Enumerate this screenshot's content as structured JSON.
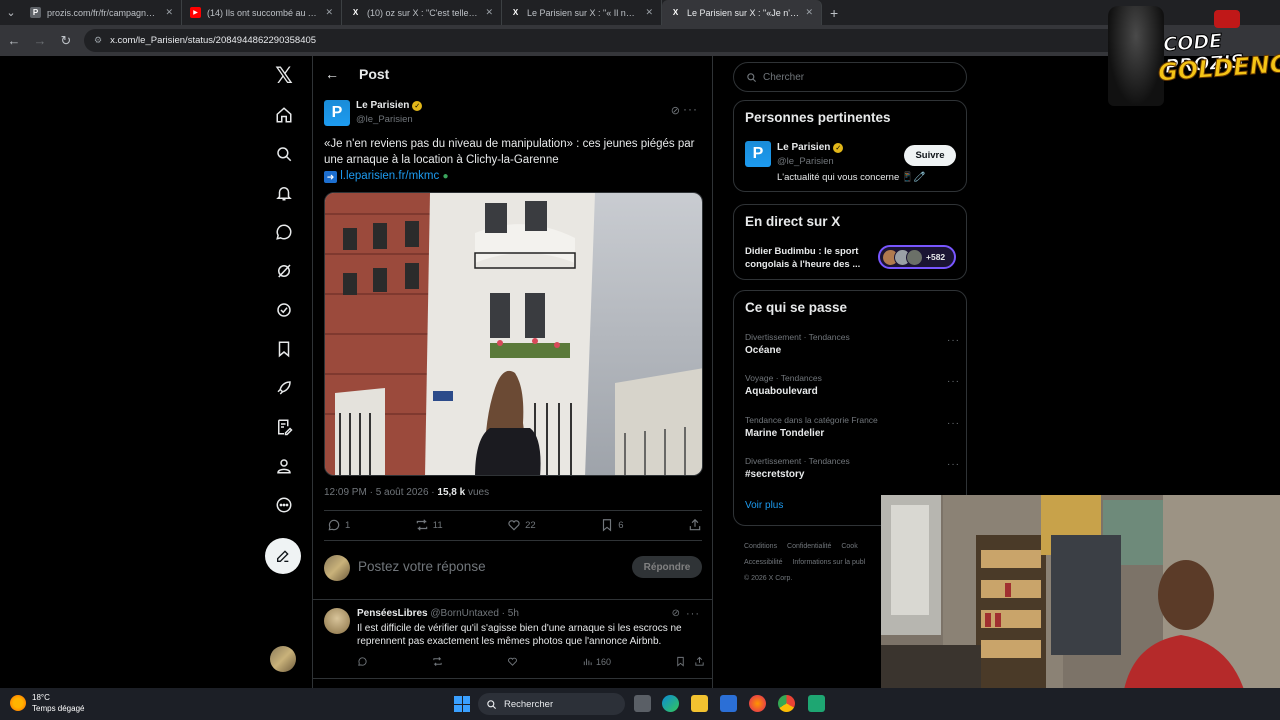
{
  "browser": {
    "tabs": [
      {
        "title": "prozis.com/fr/fr/campagne/74i",
        "fav_color": "#5f6368",
        "fav_char": "P",
        "active": false
      },
      {
        "title": "(14) Ils ont succombé au Air fry",
        "fav_color": "#ff0000",
        "fav_char": "▶",
        "active": false
      },
      {
        "title": "(10) oz sur X : \"C'est tellement",
        "fav_color": "#000000",
        "fav_char": "X",
        "active": false
      },
      {
        "title": "Le Parisien sur X : \"« Il nous l'a",
        "fav_color": "#000000",
        "fav_char": "X",
        "active": false
      },
      {
        "title": "Le Parisien sur X : \"«Je n'en revi",
        "fav_color": "#000000",
        "fav_char": "X",
        "active": true
      }
    ],
    "url": "x.com/le_Parisien/status/2084944862290358405"
  },
  "header": {
    "title": "Post"
  },
  "post": {
    "author_name": "Le Parisien",
    "author_handle": "@le_Parisien",
    "logo_letter": "P",
    "text": "«Je n'en reviens pas du niveau de manipulation» : ces jeunes piégés par une arnaque à la location à Clichy-la-Garenne",
    "link": "l.leparisien.fr/mkmc",
    "time": "12:09 PM · 5 août 2026 · ",
    "views_count": "15,8 k",
    "views_label": " vues",
    "replies": "1",
    "reposts": "11",
    "likes": "22",
    "bookmarks": "6"
  },
  "reply_box": {
    "placeholder": "Postez votre réponse",
    "button": "Répondre"
  },
  "comment": {
    "name": "PenséesLibres",
    "meta": " @BornUntaxed · 5h",
    "text": "Il est difficile de vérifier qu'il s'agisse bien d'une arnaque si les escrocs ne reprennent pas exactement les mêmes photos que l'annonce Airbnb.",
    "views": "160"
  },
  "right": {
    "search_placeholder": "Chercher",
    "relevant": {
      "title": "Personnes pertinentes",
      "name": "Le Parisien",
      "handle": "@le_Parisien",
      "bio": "L'actualité qui vous concerne 📱🧷",
      "follow": "Suivre"
    },
    "live": {
      "title": "En direct sur X",
      "text": "Didier Budimbu : le sport congolais à l'heure des ...",
      "count": "+582"
    },
    "trends": {
      "title": "Ce qui se passe",
      "items": [
        {
          "category": "Divertissement · Tendances",
          "name": "Océane"
        },
        {
          "category": "Voyage · Tendances",
          "name": "Aquaboulevard"
        },
        {
          "category": "Tendance dans la catégorie France",
          "name": "Marine Tondelier"
        },
        {
          "category": "Divertissement · Tendances",
          "name": "#secretstory"
        }
      ],
      "see_more": "Voir plus"
    },
    "footer": [
      "Conditions",
      "Confidentialité",
      "Cook",
      "Accessibilité",
      "Informations sur la publ",
      "© 2026 X Corp."
    ]
  },
  "overlay": {
    "brand_line1": "CODE PROZIS",
    "brand_line2": "GOLDENG"
  },
  "taskbar": {
    "temp": "18°C",
    "weather": "Temps dégagé",
    "search": "Rechercher"
  },
  "colors": {
    "accent": "#1d9bf0",
    "background": "#000000",
    "border": "#2f3336",
    "muted": "#71767b"
  }
}
